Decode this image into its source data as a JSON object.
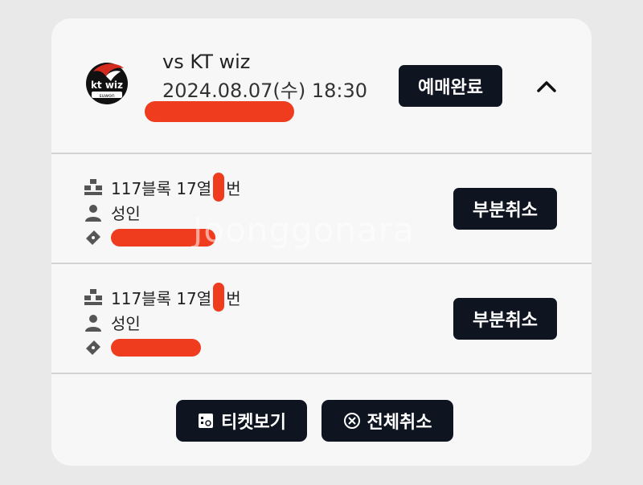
{
  "match": {
    "title": "vs KT wiz",
    "datetime": "2024.08.07(수) 18:30",
    "status_badge": "예매완료",
    "logo": {
      "line1": "kt wiz",
      "line2": "suwon"
    }
  },
  "tickets": [
    {
      "seat_prefix": "117블록 17열 ",
      "seat_suffix": "번",
      "audience": "성인"
    },
    {
      "seat_prefix": "117블록 17열 ",
      "seat_suffix": "번",
      "audience": "성인"
    }
  ],
  "buttons": {
    "partial_cancel": "부분취소",
    "view_ticket": "티켓보기",
    "cancel_all": "전체취소"
  },
  "watermark": "Joonggonara",
  "colors": {
    "dark_button": "#0f1520",
    "redaction": "#ef3b1e",
    "card": "#f7f7f7",
    "page": "#e9e9e9"
  },
  "icons": [
    "seat-icon",
    "person-icon",
    "ticket-icon",
    "chevron-up-icon",
    "ticket-view-icon",
    "cancel-circle-icon"
  ]
}
